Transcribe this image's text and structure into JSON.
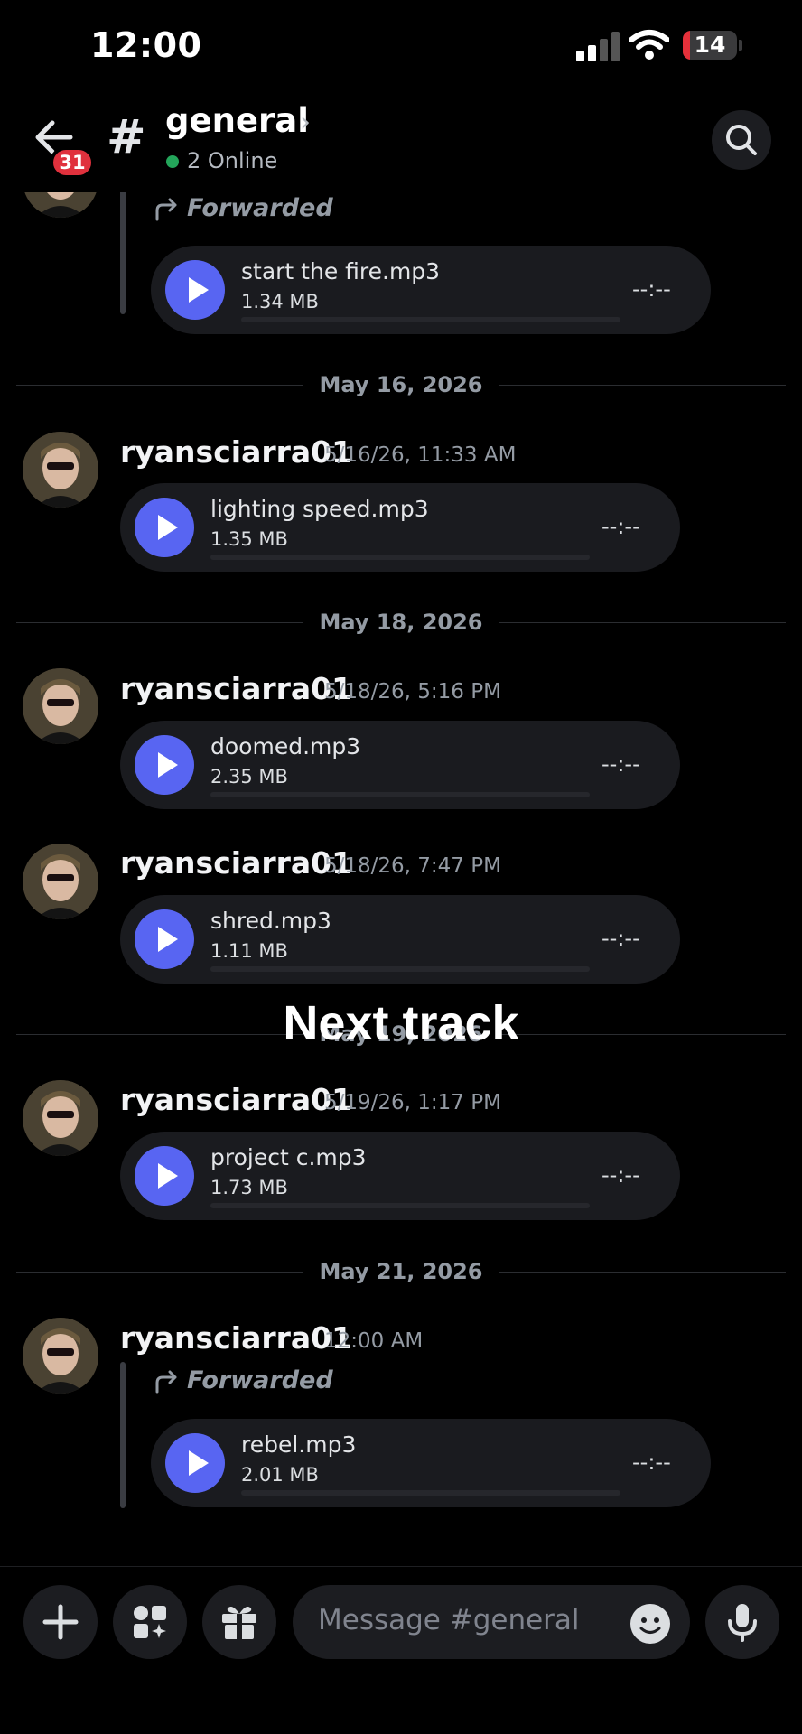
{
  "status_bar": {
    "time": "12:00",
    "battery": "14",
    "battery_level": 0.14
  },
  "header": {
    "back_badge": "31",
    "channel_hash": "#",
    "channel_name": "general",
    "chevron": "›",
    "online": "2 Online"
  },
  "dates": [
    "May 16, 2026",
    "May 18, 2026",
    "May 19, 2026",
    "May 21, 2026"
  ],
  "forwarded_label": "Forwarded",
  "messages": [
    {
      "username": "",
      "timestamp": "",
      "forwarded": true,
      "file": "start the fire.mp3",
      "size": "1.34 MB",
      "duration": "--:--"
    },
    {
      "username": "ryansciarra01",
      "timestamp": "5/16/26, 11:33 AM",
      "forwarded": false,
      "file": "lighting speed.mp3",
      "size": "1.35 MB",
      "duration": "--:--"
    },
    {
      "username": "ryansciarra01",
      "timestamp": "5/18/26, 5:16 PM",
      "forwarded": false,
      "file": "doomed.mp3",
      "size": "2.35 MB",
      "duration": "--:--"
    },
    {
      "username": "ryansciarra01",
      "timestamp": "5/18/26, 7:47 PM",
      "forwarded": false,
      "file": "shred.mp3",
      "size": "1.11 MB",
      "duration": "--:--"
    },
    {
      "username": "ryansciarra01",
      "timestamp": "5/19/26, 1:17 PM",
      "forwarded": false,
      "file": "project c.mp3",
      "size": "1.73 MB",
      "duration": "--:--"
    },
    {
      "username": "ryansciarra01",
      "timestamp": "12:00 AM",
      "forwarded": true,
      "file": "rebel.mp3",
      "size": "2.01 MB",
      "duration": "--:--"
    }
  ],
  "overlay_caption": "Next track",
  "composer": {
    "placeholder": "Message #general"
  },
  "icons": {
    "back": "arrow-left-icon",
    "search": "search-icon",
    "plus": "plus-icon",
    "apps": "apps-icon",
    "gift": "gift-icon",
    "emoji": "emoji-icon",
    "mic": "microphone-icon",
    "play": "play-icon",
    "forward": "forward-arrow-icon"
  },
  "colors": {
    "accent": "#5865f2",
    "online": "#23a55a",
    "badge": "#e0313d",
    "background": "#000000"
  }
}
